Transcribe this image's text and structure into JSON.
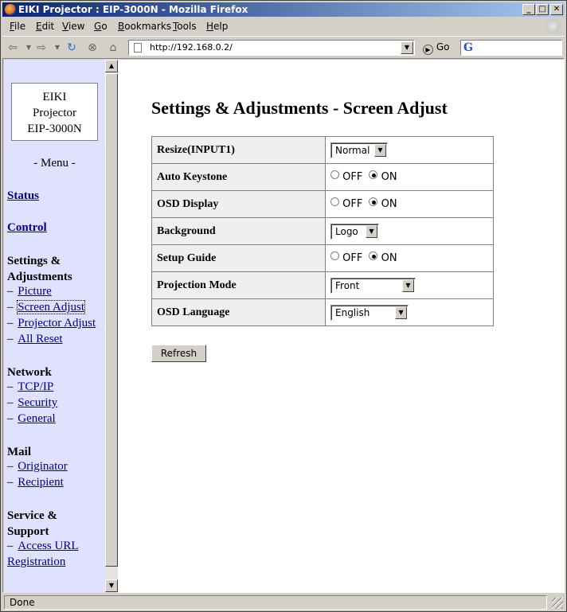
{
  "window": {
    "title": "EIKI Projector : EIP-3000N - Mozilla Firefox",
    "minimize_glyph": "_",
    "maximize_glyph": "□",
    "close_glyph": "✕"
  },
  "menubar": {
    "items": [
      {
        "key": "F",
        "rest": "ile"
      },
      {
        "key": "E",
        "rest": "dit"
      },
      {
        "key": "V",
        "rest": "iew"
      },
      {
        "key": "G",
        "rest": "o"
      },
      {
        "key": "B",
        "rest": "ookmarks"
      },
      {
        "key": "T",
        "rest": "ools"
      },
      {
        "key": "H",
        "rest": "elp"
      }
    ]
  },
  "navbar": {
    "back_glyph": "⇦",
    "forward_glyph": "⇨",
    "reload_glyph": "↻",
    "stop_glyph": "⊗",
    "home_glyph": "⌂",
    "url": "http://192.168.0.2/",
    "go_label": "Go",
    "search_engine_glyph": "G"
  },
  "sidebar": {
    "logo_lines": [
      "EIKI",
      "Projector",
      "EIP-3000N"
    ],
    "menu_heading": "- Menu -",
    "status_link": "Status",
    "control_link": "Control",
    "settings_heading_lines": [
      "Settings &",
      "Adjustments"
    ],
    "settings_items": [
      "Picture",
      "Screen Adjust",
      "Projector Adjust",
      "All Reset"
    ],
    "network_heading": "Network",
    "network_items": [
      "TCP/IP",
      "Security",
      "General"
    ],
    "mail_heading": "Mail",
    "mail_items": [
      "Originator",
      "Recipient"
    ],
    "service_heading_lines": [
      "Service &",
      "Support"
    ],
    "service_items": [
      "Access URL"
    ],
    "registration_link": "Registration",
    "item_prefix": "–"
  },
  "main": {
    "page_title": "Settings & Adjustments - Screen Adjust",
    "rows": [
      {
        "label": "Resize(INPUT1)",
        "type": "select",
        "value": "Normal"
      },
      {
        "label": "Auto Keystone",
        "type": "radio",
        "off_label": "OFF",
        "on_label": "ON",
        "selected": "ON"
      },
      {
        "label": "OSD Display",
        "type": "radio",
        "off_label": "OFF",
        "on_label": "ON",
        "selected": "ON"
      },
      {
        "label": "Background",
        "type": "select",
        "value": "Logo"
      },
      {
        "label": "Setup Guide",
        "type": "radio",
        "off_label": "OFF",
        "on_label": "ON",
        "selected": "ON"
      },
      {
        "label": "Projection Mode",
        "type": "select",
        "value": "Front"
      },
      {
        "label": "OSD Language",
        "type": "select",
        "value": "English"
      }
    ],
    "refresh_label": "Refresh"
  },
  "statusbar": {
    "text": "Done"
  }
}
